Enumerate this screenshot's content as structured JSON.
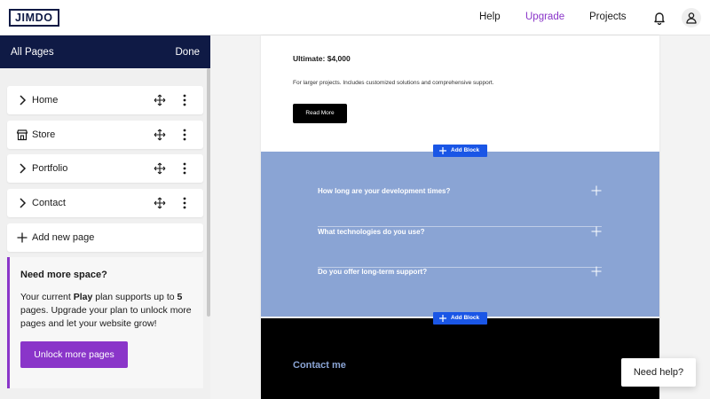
{
  "topbar": {
    "logo": "JIMDO",
    "nav": {
      "help": "Help",
      "upgrade": "Upgrade",
      "projects": "Projects"
    },
    "icons": {
      "notifications": "bell-icon",
      "account": "user-icon"
    },
    "colors": {
      "upgrade": "#8a35c9"
    }
  },
  "sidebar": {
    "title": "All Pages",
    "done_label": "Done",
    "pages": [
      {
        "label": "Home",
        "icon": "chevron-right-icon"
      },
      {
        "label": "Store",
        "icon": "store-icon"
      },
      {
        "label": "Portfolio",
        "icon": "chevron-right-icon"
      },
      {
        "label": "Contact",
        "icon": "chevron-right-icon"
      }
    ],
    "add_page_label": "Add new page",
    "upsell": {
      "heading": "Need more space?",
      "body_prefix": "Your current ",
      "plan": "Play",
      "body_middle": " plan supports up to ",
      "limit": "5",
      "body_suffix": " pages. Upgrade your plan to unlock more pages and let your website grow!",
      "cta": "Unlock more pages"
    },
    "colors": {
      "header_bg": "#0f1a45",
      "accent": "#8a35c9"
    }
  },
  "canvas": {
    "pricing": {
      "title": "Ultimate: $4,000",
      "description": "For larger projects. Includes customized solutions and comprehensive support.",
      "button": "Read More"
    },
    "add_block_label": "Add Block",
    "faq": [
      {
        "question": "How long are your development times?"
      },
      {
        "question": "What technologies do you use?"
      },
      {
        "question": "Do you offer long-term support?"
      }
    ],
    "contact_title": "Contact me",
    "colors": {
      "faq_bg": "#8aa4d4",
      "add_block": "#1a56e6"
    }
  },
  "help_button": "Need help?"
}
